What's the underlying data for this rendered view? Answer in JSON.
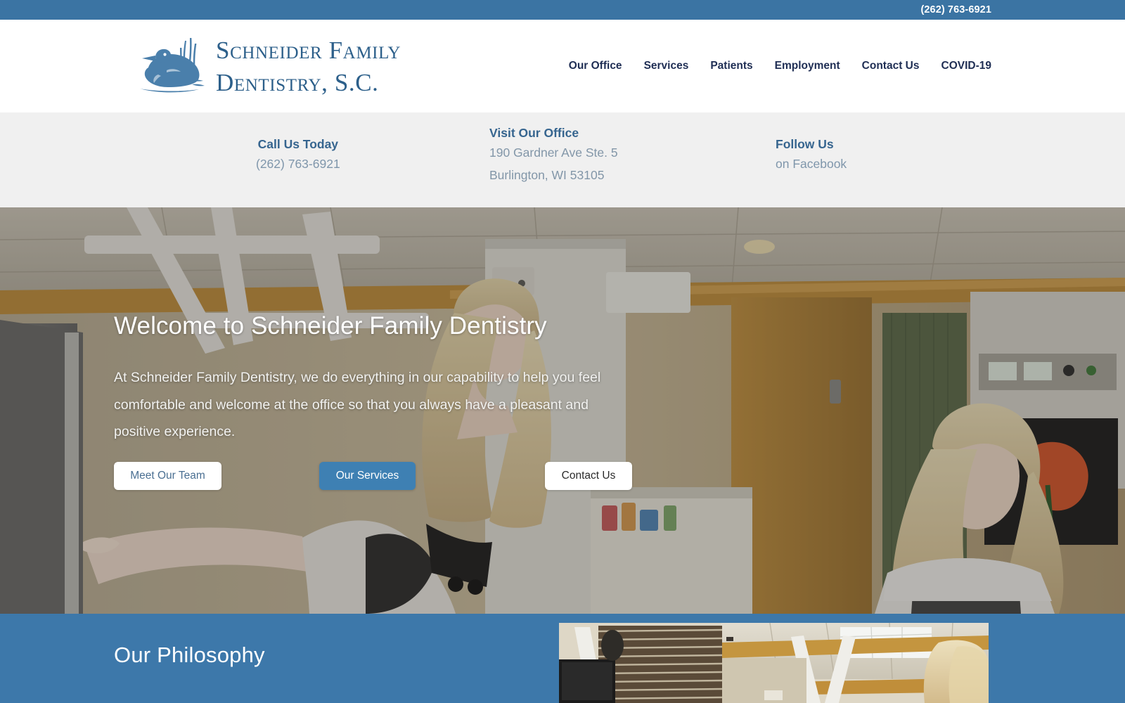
{
  "topbar": {
    "phone": "(262) 763-6921"
  },
  "header": {
    "logo_icon": "loon-bird-logo-icon",
    "brand_line1": "Schneider Family",
    "brand_line2": "Dentistry, S.C.",
    "nav": [
      {
        "label": "Our Office"
      },
      {
        "label": "Services"
      },
      {
        "label": "Patients"
      },
      {
        "label": "Employment"
      },
      {
        "label": "Contact Us"
      },
      {
        "label": "COVID-19"
      }
    ]
  },
  "infobar": {
    "call": {
      "title": "Call Us Today",
      "value": "(262) 763-6921"
    },
    "visit": {
      "title": "Visit Our Office",
      "address_line1": "190 Gardner Ave Ste. 5",
      "address_line2": "Burlington, WI 53105"
    },
    "follow": {
      "title": "Follow Us",
      "value": "on Facebook"
    }
  },
  "hero": {
    "title": "Welcome to Schneider Family Dentistry",
    "paragraph": "At Schneider Family Dentistry, we do everything in our capability to help you feel comfortable and welcome at the office so that you always have a pleasant and positive experience.",
    "buttons": [
      {
        "label": "Meet Our Team"
      },
      {
        "label": "Our Services"
      },
      {
        "label": "Contact Us"
      }
    ],
    "image_alt": "dental-operatory-hygienist-pointing-patient-photo"
  },
  "philosophy": {
    "title": "Our Philosophy",
    "image_alt": "dental-office-interior-photo"
  },
  "colors": {
    "brand_blue": "#3b74a3",
    "section_blue": "#3d78aa",
    "button_blue": "#3e80b3",
    "nav_navy": "#1f2e54",
    "info_title_blue": "#36658f",
    "info_text_gray": "#7f96ab",
    "infobar_bg": "#f0f0f0"
  }
}
